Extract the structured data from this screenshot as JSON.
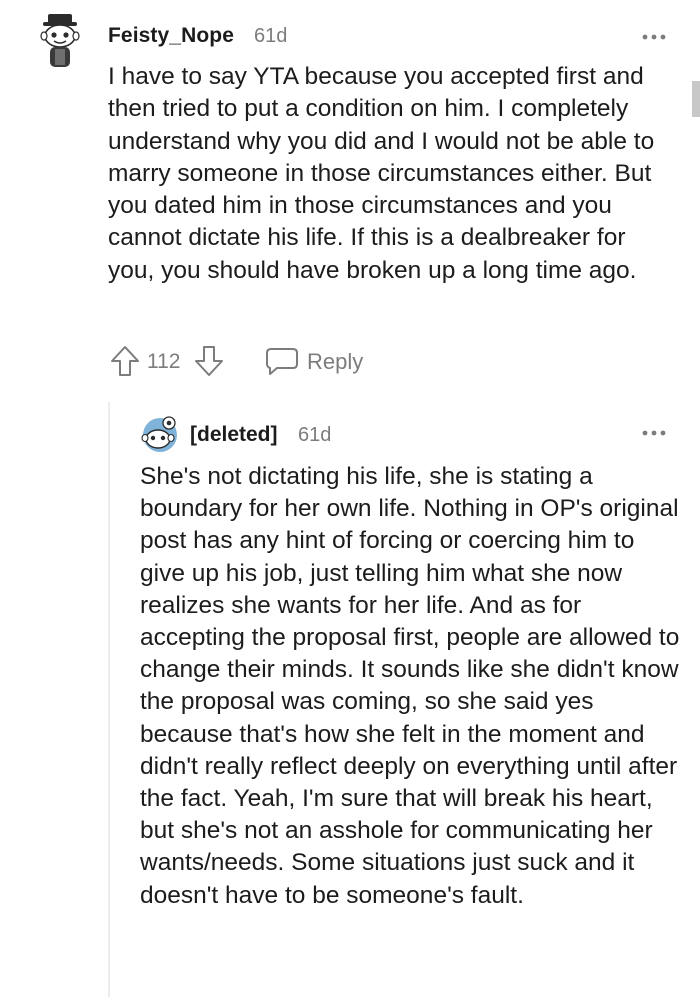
{
  "comment": {
    "username": "Feisty_Nope",
    "age": "61d",
    "body": "I have to say YTA because you accepted first and then tried to put a condition on him. I completely understand why you did and I would not be able to marry someone in those circumstances either. But you dated him in those circumstances and you cannot dictate his life. If this is a dealbreaker for you, you should have broken up a long time ago.",
    "score": "112",
    "reply_label": "Reply",
    "avatar_icon": "snoo-avatar-icon",
    "more_icon": "more-options-icon"
  },
  "reply": {
    "username": "[deleted]",
    "age": "61d",
    "body": "She's not dictating his life, she is stating a boundary for her own life. Nothing in OP's original post has any hint of forcing or coercing him to give up his job, just telling him what she now realizes she wants for her life. And as for accepting the proposal first, people are allowed to change their minds. It sounds like she didn't know the proposal was coming, so she said yes because that's how she felt in the moment and didn't really reflect deeply on everything until after the fact. Yeah, I'm sure that will break his heart, but she's not an asshole for communicating her wants/needs. Some situations just suck and it doesn't have to be someone's fault.",
    "avatar_icon": "deleted-user-avatar-icon",
    "more_icon": "more-options-icon"
  },
  "colors": {
    "text": "#1c1c1c",
    "meta": "#7c7c7c",
    "avatar_blue": "#7fb3d9"
  }
}
